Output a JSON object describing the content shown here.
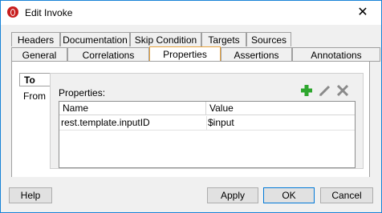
{
  "window": {
    "title": "Edit Invoke",
    "close_glyph": "✕"
  },
  "tabs_row1": [
    "Headers",
    "Documentation",
    "Skip Condition",
    "Targets",
    "Sources"
  ],
  "tabs_row2": [
    "General",
    "Correlations",
    "Properties",
    "Assertions",
    "Annotations"
  ],
  "active_tab": "Properties",
  "side_tabs": {
    "to": "To",
    "from": "From"
  },
  "properties": {
    "label": "Properties:",
    "toolbar": {
      "add": "add-icon",
      "edit": "edit-icon",
      "delete": "delete-icon"
    },
    "columns": [
      "Name",
      "Value"
    ],
    "rows": [
      {
        "name": "rest.template.inputID",
        "value": "$input"
      }
    ]
  },
  "buttons": {
    "help": "Help",
    "apply": "Apply",
    "ok": "OK",
    "cancel": "Cancel"
  },
  "colors": {
    "accent_border": "#1883d7",
    "active_tab_border": "#e8a33d",
    "add_icon": "#2ea62e"
  }
}
